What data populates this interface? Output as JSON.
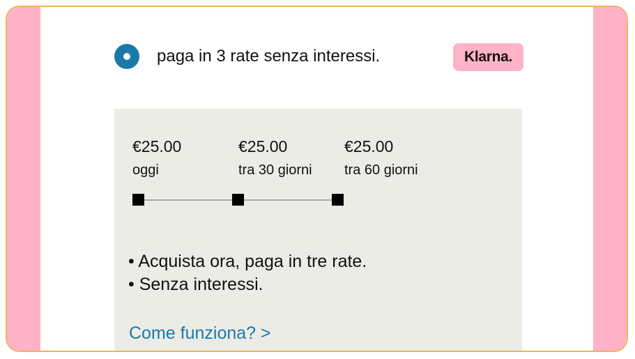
{
  "payment_option": {
    "label": "paga in 3 rate senza interessi.",
    "selected": true,
    "badge": "Klarna."
  },
  "installments": [
    {
      "amount": "€25.00",
      "when": "oggi"
    },
    {
      "amount": "€25.00",
      "when": "tra 30 giorni"
    },
    {
      "amount": "€25.00",
      "when": "tra 60 giorni"
    }
  ],
  "bullets": [
    "• Acquista ora, paga in tre rate.",
    "• Senza interessi."
  ],
  "link": {
    "label": "Come funziona? >"
  },
  "colors": {
    "accent": "#1a79a9",
    "klarna_pink": "#ffb3c7",
    "panel_bg": "#ecece7",
    "frame_border": "#f0b35a"
  },
  "icons": {
    "radio": "radio-selected-icon",
    "timeline_marker": "square-marker-icon"
  }
}
